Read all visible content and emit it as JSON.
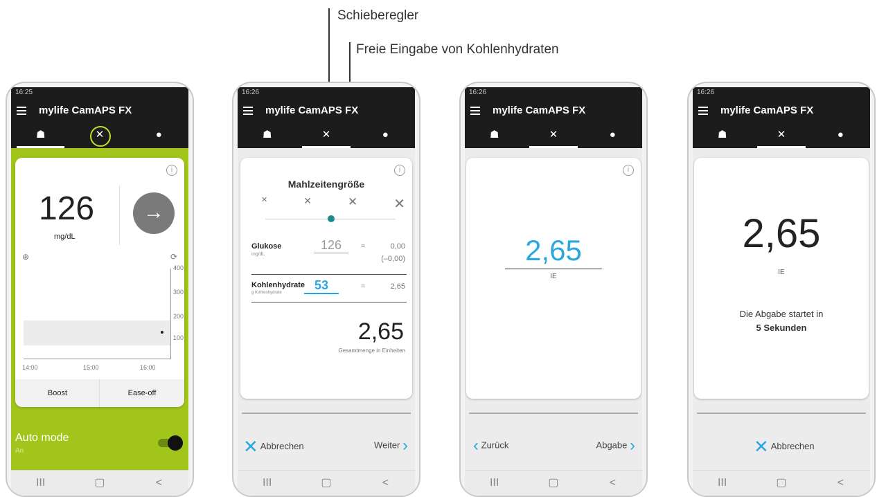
{
  "callouts": {
    "slider": "Schieberegler",
    "free_entry": "Freie Eingabe von Kohlenhydraten"
  },
  "common": {
    "app_title": "mylife CamAPS FX",
    "tabs": [
      "☗",
      "✕",
      "●"
    ],
    "nav": [
      "III",
      "▢",
      "<"
    ],
    "accent": "#29a8e0",
    "green": "#a2c51b"
  },
  "screen1": {
    "status": "16:25",
    "glucose_value": "126",
    "glucose_unit": "mg/dL",
    "y_ticks": [
      "400",
      "300",
      "200",
      "100"
    ],
    "x_ticks": [
      "14:00",
      "15:00",
      "16:00"
    ],
    "boost": "Boost",
    "ease_off": "Ease-off",
    "auto_mode": "Auto mode",
    "auto_state": "An"
  },
  "screen2": {
    "status": "16:26",
    "meal_size": "Mahlzeitengröße",
    "glucose_label": "Glukose",
    "glucose_unit": "mg/dL",
    "glucose_value": "126",
    "glucose_eq": "=",
    "glucose_result": "0,00",
    "glucose_result2": "(–0,00)",
    "carb_label": "Kohlenhydrate",
    "carb_unit": "g Kohlenhydrate",
    "carb_value": "53",
    "carb_eq": "=",
    "carb_result": "2,65",
    "total": "2,65",
    "total_label": "Gesamtmenge in Einheiten",
    "cancel": "Abbrechen",
    "next": "Weiter"
  },
  "screen3": {
    "status": "16:26",
    "value": "2,65",
    "unit": "IE",
    "back": "Zurück",
    "deliver": "Abgabe"
  },
  "screen4": {
    "status": "16:26",
    "value": "2,65",
    "unit": "IE",
    "msg1": "Die Abgabe startet in",
    "msg2": "5 Sekunden",
    "cancel": "Abbrechen"
  }
}
